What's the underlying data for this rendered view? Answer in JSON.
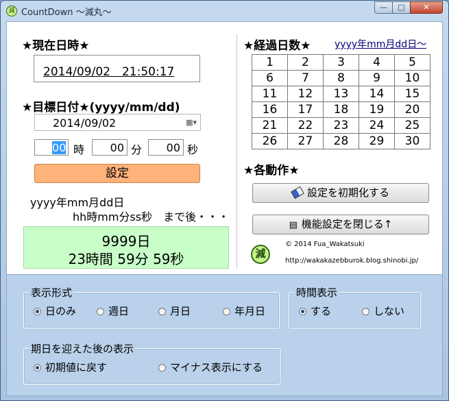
{
  "window": {
    "title": "CountDown ～減丸～",
    "icon_text": "減"
  },
  "titlebar_buttons": {
    "minimize": "—",
    "maximize": "□",
    "close": "✕"
  },
  "current": {
    "heading": "★現在日時★",
    "value": "2014/09/02　21:50:17"
  },
  "target": {
    "heading": "★目標日付★(yyyy/mm/dd)",
    "date_value": "2014/09/02",
    "hour_value": "00",
    "hour_unit": "時",
    "minute_value": "00",
    "minute_unit": "分",
    "second_value": "00",
    "second_unit": "秒",
    "set_button": "設定"
  },
  "format_label": {
    "line1": "yyyy年mm月dd日",
    "line2": "hh時mm分ss秒　まで後・・・"
  },
  "remaining": {
    "line1": "9999日",
    "line2": "23時間 59分 59秒"
  },
  "elapsed": {
    "heading": "★経過日数★",
    "link": "yyyy年mm月dd日～",
    "days": [
      [
        "1",
        "2",
        "3",
        "4",
        "5"
      ],
      [
        "6",
        "7",
        "8",
        "9",
        "10"
      ],
      [
        "11",
        "12",
        "13",
        "14",
        "15"
      ],
      [
        "16",
        "17",
        "18",
        "19",
        "20"
      ],
      [
        "21",
        "22",
        "23",
        "24",
        "25"
      ],
      [
        "26",
        "27",
        "28",
        "29",
        "30"
      ]
    ]
  },
  "actions": {
    "heading": "★各動作★",
    "reset_button": "設定を初期化する",
    "close_settings_button": "機能設定を閉じる↑"
  },
  "credits": {
    "logo_text": "減",
    "copyright": "© 2014 Fua_Wakatsuki",
    "url": "http://wakakazebburok.blog.shinobi.jp/"
  },
  "display_format": {
    "legend": "表示形式",
    "options": [
      "日のみ",
      "週日",
      "月日",
      "年月日"
    ],
    "selected": 0
  },
  "time_display": {
    "legend": "時間表示",
    "options": [
      "する",
      "しない"
    ],
    "selected": 0
  },
  "after_deadline": {
    "legend": "期日を迎えた後の表示",
    "options": [
      "初期値に戻す",
      "マイナス表示にする"
    ],
    "selected": 0
  },
  "colors": {
    "set_button": "#ffb27a",
    "remaining_bg": "#c8ffc8",
    "accent": "#1f4c7a"
  }
}
